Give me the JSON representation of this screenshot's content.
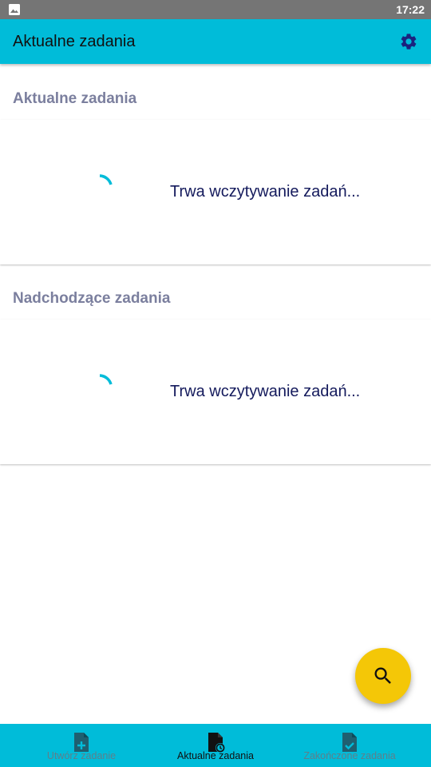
{
  "status_bar": {
    "time": "17:22",
    "notification_icon": "image-icon"
  },
  "app_bar": {
    "title": "Aktualne zadania",
    "settings_icon": "gear-icon"
  },
  "sections": [
    {
      "title": "Aktualne zadania",
      "loading_text": "Trwa wczytywanie zadań..."
    },
    {
      "title": "Nadchodzące zadania",
      "loading_text": "Trwa wczytywanie zadań..."
    }
  ],
  "fab": {
    "icon": "search-icon"
  },
  "bottom_nav": {
    "items": [
      {
        "label": "Utwórz zadanie",
        "icon": "document-add-icon",
        "active": false
      },
      {
        "label": "Aktualne zadania",
        "icon": "document-clock-icon",
        "active": true
      },
      {
        "label": "Zakończone zadania",
        "icon": "document-check-icon",
        "active": false
      }
    ]
  },
  "colors": {
    "primary": "#00bcd9",
    "accent": "#f4c707",
    "section_title": "#7b7f9e",
    "loading_text": "#141a5c",
    "settings_icon": "#1a237e"
  }
}
